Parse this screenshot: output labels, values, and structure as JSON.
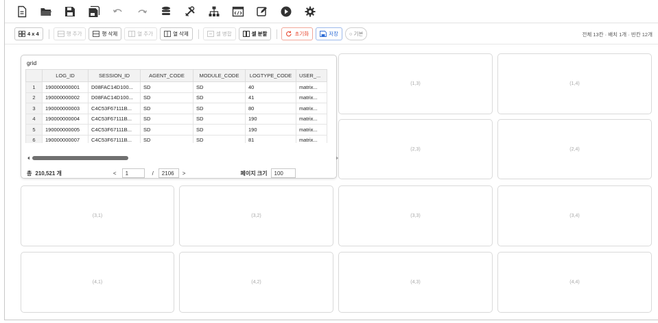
{
  "toolbar": {
    "icons": [
      "new-file-icon",
      "open-folder-icon",
      "save-icon",
      "save-as-icon",
      "undo-icon",
      "redo-icon",
      "database-icon",
      "tools-icon",
      "hierarchy-icon",
      "code-window-icon",
      "edit-icon",
      "play-icon",
      "settings-icon"
    ]
  },
  "actionbar": {
    "grid_size": "4 x 4",
    "add_row": "행 추가",
    "delete_row": "행 삭제",
    "add_col": "열 추가",
    "delete_col": "열 삭제",
    "merge": "셀 병합",
    "split": "셀 분할",
    "reset": "초기화",
    "save": "저장",
    "basic": "○ 기본",
    "summary": "전체 13칸 · 배치 1개 · 빈칸 12개"
  },
  "panel": {
    "title": "grid",
    "columns": [
      "LOG_ID",
      "SESSION_ID",
      "AGENT_CODE",
      "MODULE_CODE",
      "LOGTYPE_CODE",
      "USER_..."
    ],
    "rows": [
      {
        "n": "1",
        "log_id": "190000000001",
        "session": "D08FAC14D100...",
        "agent": "SD",
        "module": "SD",
        "logtype": "40",
        "user": "matrix..."
      },
      {
        "n": "2",
        "log_id": "190000000002",
        "session": "D08FAC14D100...",
        "agent": "SD",
        "module": "SD",
        "logtype": "41",
        "user": "matrix..."
      },
      {
        "n": "3",
        "log_id": "190000000003",
        "session": "C4C53F67111B...",
        "agent": "SD",
        "module": "SD",
        "logtype": "80",
        "user": "matrix..."
      },
      {
        "n": "4",
        "log_id": "190000000004",
        "session": "C4C53F67111B...",
        "agent": "SD",
        "module": "SD",
        "logtype": "190",
        "user": "matrix..."
      },
      {
        "n": "5",
        "log_id": "190000000005",
        "session": "C4C53F67111B...",
        "agent": "SD",
        "module": "SD",
        "logtype": "190",
        "user": "matrix..."
      },
      {
        "n": "6",
        "log_id": "190000000007",
        "session": "C4C53F67111B...",
        "agent": "SD",
        "module": "SD",
        "logtype": "81",
        "user": "matrix..."
      }
    ],
    "total_label": "총",
    "total_value": "210,521 개",
    "page_current": "1",
    "page_total": "2106",
    "page_size_label": "페이지 크기",
    "page_size": "100"
  },
  "cells": {
    "c13": "(1,3)",
    "c14": "(1,4)",
    "c23": "(2,3)",
    "c24": "(2,4)",
    "c31": "(3,1)",
    "c32": "(3,2)",
    "c33": "(3,3)",
    "c34": "(3,4)",
    "c41": "(4,1)",
    "c42": "(4,2)",
    "c43": "(4,3)",
    "c44": "(4,4)"
  }
}
